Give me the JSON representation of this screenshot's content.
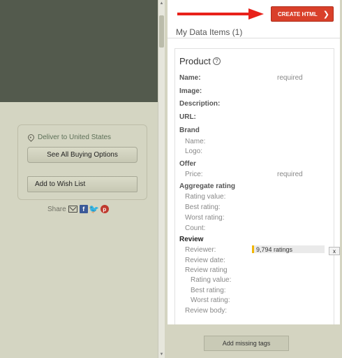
{
  "left_page": {
    "deliver_to": "Deliver to United States",
    "see_all_buying_options": "See All Buying Options",
    "add_to_wish_list": "Add to Wish List",
    "share_label": "Share"
  },
  "panel": {
    "create_html_label": "CREATE HTML",
    "my_data_items": "My Data Items (1)",
    "product_title": "Product",
    "help_glyph": "?",
    "fields": {
      "name": "Name:",
      "name_required": "required",
      "image": "Image:",
      "description": "Description:",
      "url": "URL:",
      "brand": "Brand",
      "brand_name": "Name:",
      "brand_logo": "Logo:",
      "offer": "Offer",
      "offer_price": "Price:",
      "offer_price_required": "required",
      "aggregate_rating": "Aggregate rating",
      "rating_value": "Rating value:",
      "best_rating": "Best rating:",
      "worst_rating": "Worst rating:",
      "count": "Count:",
      "review": "Review",
      "reviewer": "Reviewer:",
      "reviewer_value": "9,794 ratings",
      "review_date": "Review date:",
      "review_rating": "Review rating",
      "review_rating_value": "Rating value:",
      "review_best_rating": "Best rating:",
      "review_worst_rating": "Worst rating:",
      "review_body": "Review body:"
    },
    "remove_label": "x",
    "add_missing_tags": "Add missing tags"
  },
  "colors": {
    "create_html_bg": "#d9402a",
    "arrow_red": "#e8211a",
    "left_dark_block": "#535a4d",
    "page_bg": "#d4d4c1",
    "reviewer_marker": "#f2b705"
  },
  "icons": {
    "location": "location-pin-icon",
    "mail": "mail-icon",
    "facebook": "facebook-icon",
    "twitter": "twitter-icon",
    "pinterest": "pinterest-icon",
    "chevron": "chevron-right-icon"
  }
}
